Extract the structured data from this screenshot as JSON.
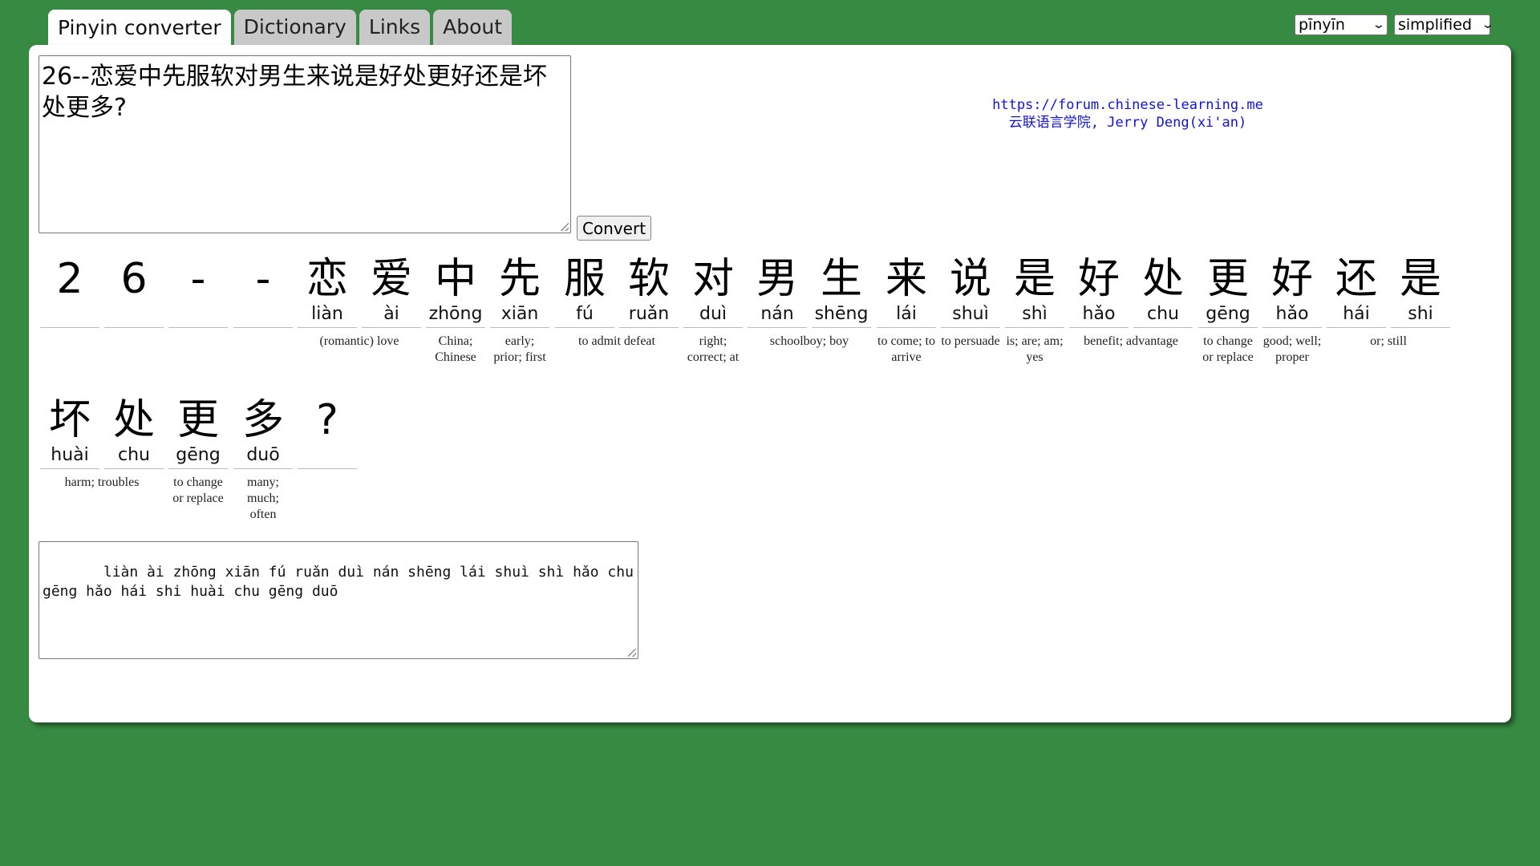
{
  "tabs": [
    {
      "label": "Pinyin converter",
      "active": true
    },
    {
      "label": "Dictionary",
      "active": false
    },
    {
      "label": "Links",
      "active": false
    },
    {
      "label": "About",
      "active": false
    }
  ],
  "selects": {
    "mode": "pīnyīn",
    "script": "simplified",
    "chevron_icon": "chevron-down-icon"
  },
  "input": {
    "value": "26--恋爱中先服软对男生来说是好处更好还是坏处更多?"
  },
  "convert_label": "Convert",
  "credits": {
    "line1": "https://forum.chinese-learning.me",
    "line2": "云联语言学院, Jerry Deng(xi'an)"
  },
  "rows": [
    {
      "chars": [
        {
          "zi": "2",
          "py": ""
        },
        {
          "zi": "6",
          "py": ""
        },
        {
          "zi": "-",
          "py": ""
        },
        {
          "zi": "-",
          "py": ""
        },
        {
          "zi": "恋",
          "py": "liàn"
        },
        {
          "zi": "爱",
          "py": "ài"
        },
        {
          "zi": "中",
          "py": "zhōng"
        },
        {
          "zi": "先",
          "py": "xiān"
        },
        {
          "zi": "服",
          "py": "fú"
        },
        {
          "zi": "软",
          "py": "ruǎn"
        },
        {
          "zi": "对",
          "py": "duì"
        },
        {
          "zi": "男",
          "py": "nán"
        },
        {
          "zi": "生",
          "py": "shēng"
        },
        {
          "zi": "来",
          "py": "lái"
        },
        {
          "zi": "说",
          "py": "shuì"
        },
        {
          "zi": "是",
          "py": "shì"
        },
        {
          "zi": "好",
          "py": "hǎo"
        },
        {
          "zi": "处",
          "py": "chu"
        },
        {
          "zi": "更",
          "py": "gēng"
        },
        {
          "zi": "好",
          "py": "hǎo"
        },
        {
          "zi": "还",
          "py": "hái"
        },
        {
          "zi": "是",
          "py": "shi"
        }
      ],
      "defs": [
        {
          "start": 4,
          "span": 2,
          "text": "(romantic) love"
        },
        {
          "start": 6,
          "span": 1,
          "text": "China; Chinese"
        },
        {
          "start": 7,
          "span": 1,
          "text": "early; prior; first"
        },
        {
          "start": 8,
          "span": 2,
          "text": "to admit defeat"
        },
        {
          "start": 10,
          "span": 1,
          "text": "right; correct; at"
        },
        {
          "start": 11,
          "span": 2,
          "text": "schoolboy; boy"
        },
        {
          "start": 13,
          "span": 1,
          "text": "to come; to arrive"
        },
        {
          "start": 14,
          "span": 1,
          "text": "to persuade"
        },
        {
          "start": 15,
          "span": 1,
          "text": "is; are; am; yes"
        },
        {
          "start": 16,
          "span": 2,
          "text": "benefit; advantage"
        },
        {
          "start": 18,
          "span": 1,
          "text": "to change or replace"
        },
        {
          "start": 19,
          "span": 1,
          "text": "good; well; proper"
        },
        {
          "start": 20,
          "span": 2,
          "text": "or; still"
        }
      ]
    },
    {
      "chars": [
        {
          "zi": "坏",
          "py": "huài"
        },
        {
          "zi": "处",
          "py": "chu"
        },
        {
          "zi": "更",
          "py": "gēng"
        },
        {
          "zi": "多",
          "py": "duō"
        },
        {
          "zi": "?",
          "py": ""
        }
      ],
      "defs": [
        {
          "start": 0,
          "span": 2,
          "text": "harm; troubles"
        },
        {
          "start": 2,
          "span": 1,
          "text": "to change or replace"
        },
        {
          "start": 3,
          "span": 1,
          "text": "many; much; often"
        }
      ]
    }
  ],
  "output": {
    "value": "   liàn ài zhōng xiān fú ruǎn duì nán shēng lái shuì shì hǎo chu gēng hǎo hái shi huài chu gēng duō"
  }
}
